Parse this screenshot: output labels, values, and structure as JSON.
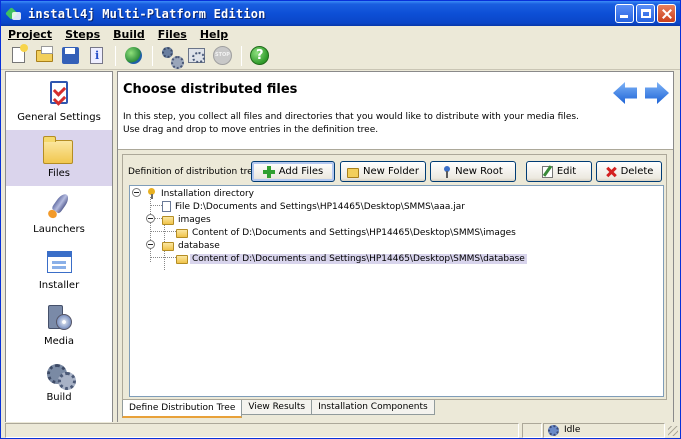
{
  "window": {
    "title": "install4j Multi-Platform Edition"
  },
  "menu": {
    "items": [
      {
        "name": "menu-project",
        "label": "Project"
      },
      {
        "name": "menu-steps",
        "label": "Steps"
      },
      {
        "name": "menu-build",
        "label": "Build"
      },
      {
        "name": "menu-files",
        "label": "Files"
      },
      {
        "name": "menu-help",
        "label": "Help"
      }
    ]
  },
  "toolbar": {
    "icons": [
      "new-project-icon",
      "open-project-icon",
      "save-project-icon",
      "project-info-icon",
      "start-build-icon",
      "build-settings-icon",
      "build-project-icon",
      "stop-build-icon",
      "help-icon"
    ]
  },
  "sidebar": {
    "items": [
      {
        "label": "General Settings",
        "icon": "checklist-icon",
        "selected": false
      },
      {
        "label": "Files",
        "icon": "folder-icon",
        "selected": true
      },
      {
        "label": "Launchers",
        "icon": "rocket-icon",
        "selected": false
      },
      {
        "label": "Installer",
        "icon": "installer-window-icon",
        "selected": false
      },
      {
        "label": "Media",
        "icon": "media-disc-icon",
        "selected": false
      },
      {
        "label": "Build",
        "icon": "gears-icon",
        "selected": false
      }
    ]
  },
  "header": {
    "title": "Choose distributed files",
    "description": "In this step, you collect all files and directories that you would like to distribute with your media files. Use drag and drop to move entries in the definition tree."
  },
  "panel": {
    "tree_label": "Definition of distribution tree:",
    "buttons": {
      "add_files": "Add Files",
      "new_folder": "New Folder",
      "new_root": "New Root",
      "edit": "Edit",
      "delete": "Delete"
    }
  },
  "tree": {
    "nodes": [
      {
        "label": "Installation directory",
        "type": "root"
      },
      {
        "label": "File D:\\Documents and Settings\\HP14465\\Desktop\\SMMS\\aaa.jar",
        "type": "file"
      },
      {
        "label": "images",
        "type": "folder"
      },
      {
        "label": "Content of D:\\Documents and Settings\\HP14465\\Desktop\\SMMS\\images",
        "type": "folder"
      },
      {
        "label": "database",
        "type": "folder"
      },
      {
        "label": "Content of D:\\Documents and Settings\\HP14465\\Desktop\\SMMS\\database",
        "type": "folder",
        "selected": true
      }
    ]
  },
  "tabs": {
    "items": [
      {
        "label": "Define Distribution Tree",
        "active": true
      },
      {
        "label": "View Results",
        "active": false
      },
      {
        "label": "Installation Components",
        "active": false
      }
    ]
  },
  "status": {
    "state": "Idle"
  }
}
